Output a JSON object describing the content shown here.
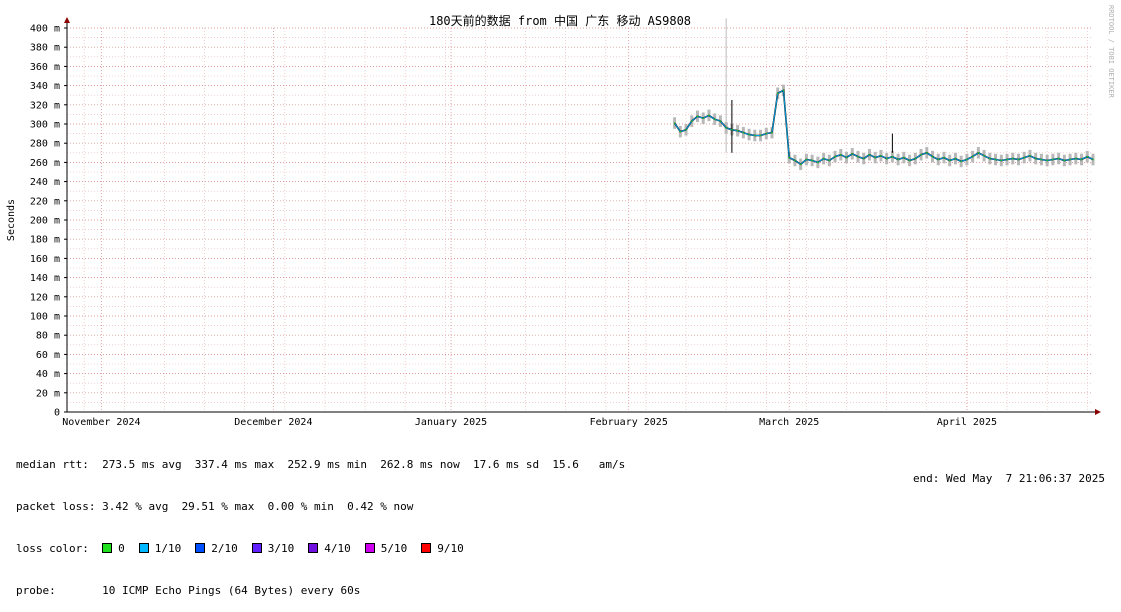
{
  "chart_data": {
    "type": "line",
    "title": "180天前的数据 from 中国 广东 移动 AS9808",
    "ylabel": "Seconds",
    "watermark": "RRDTOOL / TOBI OETIKER",
    "ylim": [
      0,
      400
    ],
    "yticks": [
      {
        "v": 0,
        "label": "0"
      },
      {
        "v": 20,
        "label": "20 m"
      },
      {
        "v": 40,
        "label": "40 m"
      },
      {
        "v": 60,
        "label": "60 m"
      },
      {
        "v": 80,
        "label": "80 m"
      },
      {
        "v": 100,
        "label": "100 m"
      },
      {
        "v": 120,
        "label": "120 m"
      },
      {
        "v": 140,
        "label": "140 m"
      },
      {
        "v": 160,
        "label": "160 m"
      },
      {
        "v": 180,
        "label": "180 m"
      },
      {
        "v": 200,
        "label": "200 m"
      },
      {
        "v": 220,
        "label": "220 m"
      },
      {
        "v": 240,
        "label": "240 m"
      },
      {
        "v": 260,
        "label": "260 m"
      },
      {
        "v": 280,
        "label": "280 m"
      },
      {
        "v": 300,
        "label": "300 m"
      },
      {
        "v": 320,
        "label": "320 m"
      },
      {
        "v": 340,
        "label": "340 m"
      },
      {
        "v": 360,
        "label": "360 m"
      },
      {
        "v": 380,
        "label": "380 m"
      },
      {
        "v": 400,
        "label": "400 m"
      }
    ],
    "xlim": [
      "2024-11-09",
      "2025-05-07"
    ],
    "xticks": [
      {
        "date": "2024-11-15",
        "label": "November 2024"
      },
      {
        "date": "2024-12-15",
        "label": "December 2024"
      },
      {
        "date": "2025-01-15",
        "label": "January 2025"
      },
      {
        "date": "2025-02-15",
        "label": "February 2025"
      },
      {
        "date": "2025-03-15",
        "label": "March 2025"
      },
      {
        "date": "2025-04-15",
        "label": "April 2025"
      }
    ],
    "grid": true,
    "series": [
      {
        "name": "median rtt",
        "points": [
          [
            "2025-02-23",
            301
          ],
          [
            "2025-02-24",
            292
          ],
          [
            "2025-02-25",
            294
          ],
          [
            "2025-02-26",
            303
          ],
          [
            "2025-02-27",
            308
          ],
          [
            "2025-02-28",
            306
          ],
          [
            "2025-03-01",
            309
          ],
          [
            "2025-03-02",
            305
          ],
          [
            "2025-03-03",
            303
          ],
          [
            "2025-03-04",
            296
          ],
          [
            "2025-03-05",
            294
          ],
          [
            "2025-03-06",
            293
          ],
          [
            "2025-03-07",
            291
          ],
          [
            "2025-03-08",
            289
          ],
          [
            "2025-03-09",
            288
          ],
          [
            "2025-03-10",
            288
          ],
          [
            "2025-03-11",
            290
          ],
          [
            "2025-03-12",
            291
          ],
          [
            "2025-03-13",
            332
          ],
          [
            "2025-03-14",
            335
          ],
          [
            "2025-03-15",
            265
          ],
          [
            "2025-03-16",
            262
          ],
          [
            "2025-03-17",
            258
          ],
          [
            "2025-03-18",
            263
          ],
          [
            "2025-03-19",
            262
          ],
          [
            "2025-03-20",
            260
          ],
          [
            "2025-03-21",
            264
          ],
          [
            "2025-03-22",
            262
          ],
          [
            "2025-03-23",
            266
          ],
          [
            "2025-03-24",
            268
          ],
          [
            "2025-03-25",
            265
          ],
          [
            "2025-03-26",
            269
          ],
          [
            "2025-03-27",
            266
          ],
          [
            "2025-03-28",
            264
          ],
          [
            "2025-03-29",
            268
          ],
          [
            "2025-03-30",
            265
          ],
          [
            "2025-03-31",
            267
          ],
          [
            "2025-04-01",
            264
          ],
          [
            "2025-04-02",
            266
          ],
          [
            "2025-04-03",
            263
          ],
          [
            "2025-04-04",
            265
          ],
          [
            "2025-04-05",
            262
          ],
          [
            "2025-04-06",
            264
          ],
          [
            "2025-04-07",
            268
          ],
          [
            "2025-04-08",
            270
          ],
          [
            "2025-04-09",
            266
          ],
          [
            "2025-04-10",
            263
          ],
          [
            "2025-04-11",
            265
          ],
          [
            "2025-04-12",
            262
          ],
          [
            "2025-04-13",
            264
          ],
          [
            "2025-04-14",
            261
          ],
          [
            "2025-04-15",
            263
          ],
          [
            "2025-04-16",
            266
          ],
          [
            "2025-04-17",
            270
          ],
          [
            "2025-04-18",
            267
          ],
          [
            "2025-04-19",
            264
          ],
          [
            "2025-04-20",
            263
          ],
          [
            "2025-04-21",
            262
          ],
          [
            "2025-04-22",
            263
          ],
          [
            "2025-04-23",
            264
          ],
          [
            "2025-04-24",
            263
          ],
          [
            "2025-04-25",
            265
          ],
          [
            "2025-04-26",
            267
          ],
          [
            "2025-04-27",
            264
          ],
          [
            "2025-04-28",
            263
          ],
          [
            "2025-04-29",
            262
          ],
          [
            "2025-04-30",
            263
          ],
          [
            "2025-05-01",
            264
          ],
          [
            "2025-05-02",
            262
          ],
          [
            "2025-05-03",
            263
          ],
          [
            "2025-05-04",
            264
          ],
          [
            "2025-05-05",
            263
          ],
          [
            "2025-05-06",
            266
          ],
          [
            "2025-05-07",
            263
          ]
        ]
      }
    ],
    "spikes": [
      [
        "2025-03-04",
        410,
        "#bbbbbb"
      ],
      [
        "2025-03-05",
        325,
        "#000000"
      ],
      [
        "2025-04-02",
        290,
        "#000000"
      ]
    ],
    "line_color": "#00a0e0",
    "smoke_color": "#b8b8b8"
  },
  "legend": {
    "median_rtt": "median rtt:  273.5 ms avg  337.4 ms max  252.9 ms min  262.8 ms now  17.6 ms sd  15.6   am/s",
    "packet_loss": "packet loss: 3.42 % avg  29.51 % max  0.00 % min  0.42 % now",
    "loss_color_label": "loss color:  ",
    "loss_colors": [
      {
        "label": "0",
        "color": "#20e020"
      },
      {
        "label": "1/10",
        "color": "#00b8ff"
      },
      {
        "label": "2/10",
        "color": "#0050ff"
      },
      {
        "label": "3/10",
        "color": "#6020ff"
      },
      {
        "label": "4/10",
        "color": "#7010e0"
      },
      {
        "label": "5/10",
        "color": "#d000f0"
      },
      {
        "label": "9/10",
        "color": "#ff0000"
      }
    ],
    "probe": "probe:       10 ICMP Echo Pings (64 Bytes) every 60s",
    "end": "end: Wed May  7 21:06:37 2025"
  }
}
